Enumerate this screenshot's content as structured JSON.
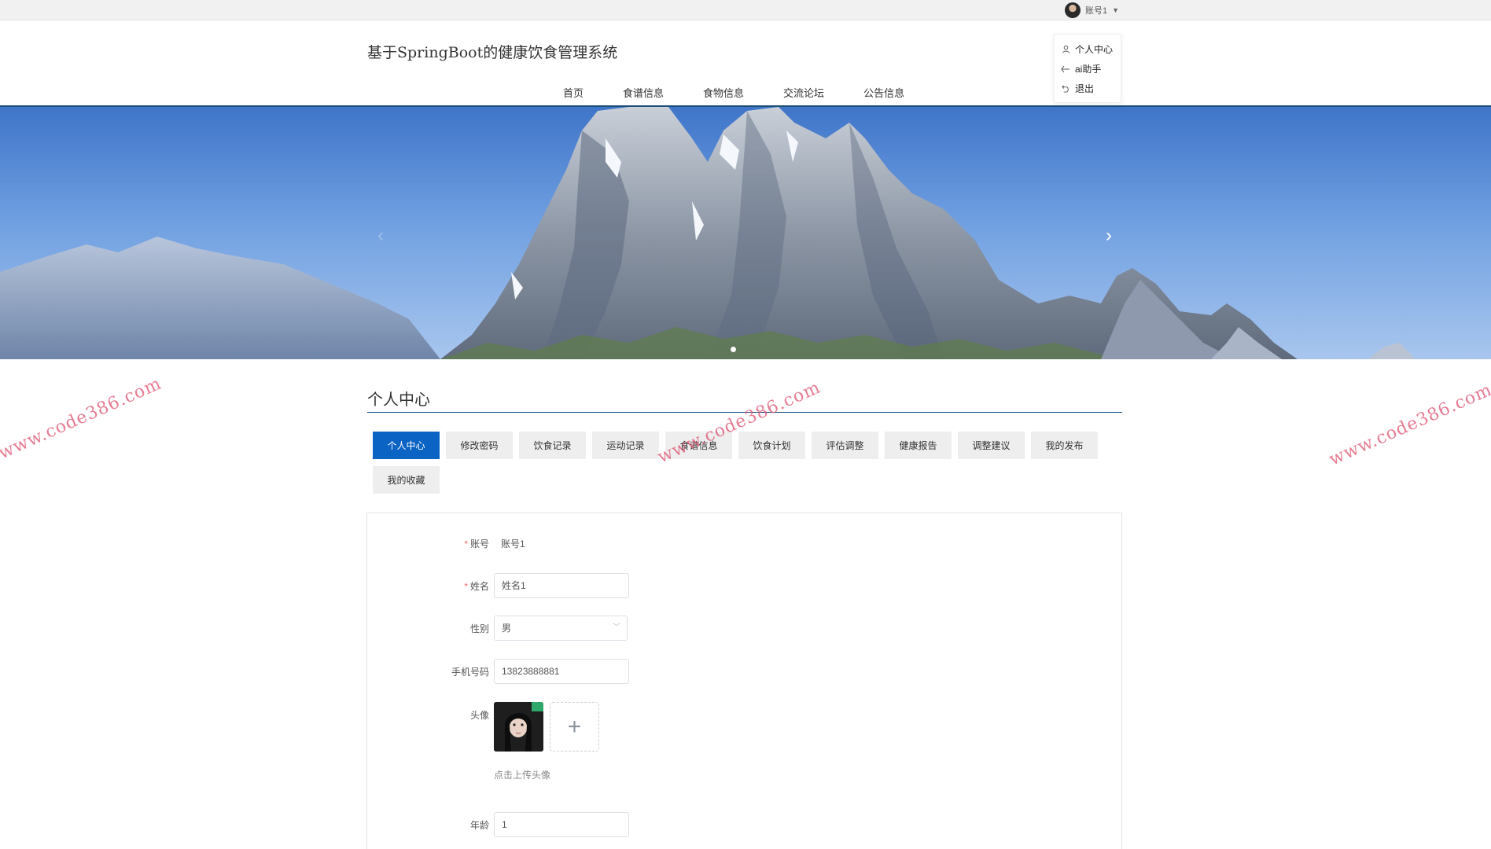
{
  "topbar": {
    "account_label": "账号1"
  },
  "header": {
    "title": "基于SpringBoot的健康饮食管理系统",
    "nav": [
      "首页",
      "食谱信息",
      "食物信息",
      "交流论坛",
      "公告信息"
    ]
  },
  "dropdown": {
    "items": [
      {
        "label": "个人中心",
        "icon": "user-icon"
      },
      {
        "label": "ai助手",
        "icon": "back-arrow-icon"
      },
      {
        "label": "退出",
        "icon": "logout-icon"
      }
    ]
  },
  "banner": {
    "slides": 1,
    "active_slide": 1
  },
  "section": {
    "title": "个人中心"
  },
  "tabs": [
    {
      "label": "个人中心",
      "active": true
    },
    {
      "label": "修改密码"
    },
    {
      "label": "饮食记录"
    },
    {
      "label": "运动记录"
    },
    {
      "label": "食谱信息"
    },
    {
      "label": "饮食计划"
    },
    {
      "label": "评估调整"
    },
    {
      "label": "健康报告"
    },
    {
      "label": "调整建议"
    },
    {
      "label": "我的发布"
    },
    {
      "label": "我的收藏"
    }
  ],
  "form": {
    "account": {
      "label": "账号",
      "required": true,
      "value": "账号1"
    },
    "name": {
      "label": "姓名",
      "required": true,
      "value": "姓名1"
    },
    "gender": {
      "label": "性别",
      "value": "男"
    },
    "phone": {
      "label": "手机号码",
      "value": "13823888881"
    },
    "avatar": {
      "label": "头像",
      "upload_icon": "plus-icon",
      "hint": "点击上传头像"
    },
    "age": {
      "label": "年龄",
      "value": "1"
    }
  },
  "watermark": {
    "text": "www.code386.com"
  },
  "colors": {
    "primary": "#0b63c4",
    "header_line": "#1d4e7a",
    "required": "#f56c6c"
  }
}
